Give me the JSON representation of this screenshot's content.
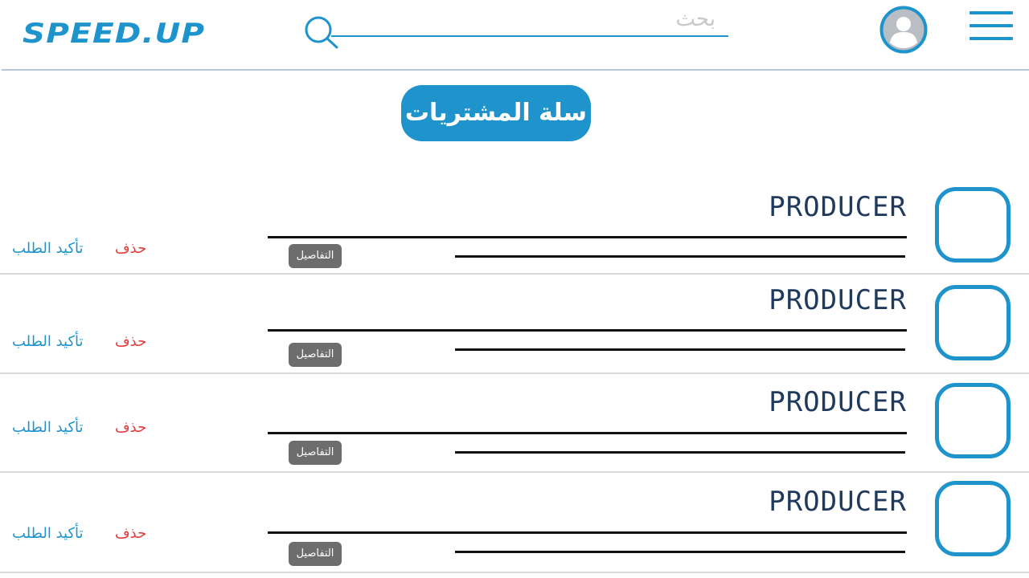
{
  "header": {
    "logo_text": "SPEED.UP",
    "search_placeholder": "بحث",
    "accent_color": "#1e93cc"
  },
  "page": {
    "title": "سلة المشتريات"
  },
  "cart": {
    "items": [
      {
        "producer": "PRODUCER",
        "details_label": "التفاصيل",
        "delete_label": "حذف",
        "confirm_label": "تأكيد الطلب"
      },
      {
        "producer": "PRODUCER",
        "details_label": "التفاصيل",
        "delete_label": "حذف",
        "confirm_label": "تأكيد الطلب"
      },
      {
        "producer": "PRODUCER",
        "details_label": "التفاصيل",
        "delete_label": "حذف",
        "confirm_label": "تأكيد الطلب"
      },
      {
        "producer": "PRODUCER",
        "details_label": "التفاصيل",
        "delete_label": "حذف",
        "confirm_label": "تأكيد الطلب"
      }
    ]
  },
  "colors": {
    "accent": "#1e93cc",
    "delete": "#e23b3b",
    "details_button": "#6d6d6d",
    "producer_text": "#1f3a5c"
  },
  "icons": {
    "search": "search-icon",
    "avatar": "user-avatar-icon",
    "menu": "hamburger-menu-icon"
  }
}
